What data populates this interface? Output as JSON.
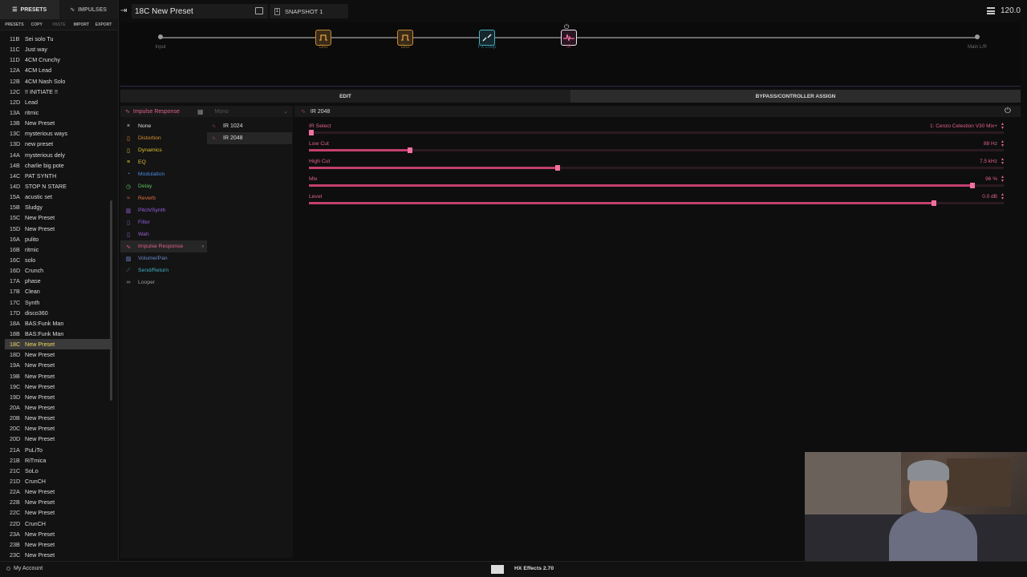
{
  "left_panel": {
    "tabs": [
      {
        "label": "PRESETS"
      },
      {
        "label": "IMPULSES"
      }
    ],
    "actions": [
      "PRESETS",
      "COPY",
      "PASTE",
      "IMPORT",
      "EXPORT"
    ],
    "presets": [
      {
        "id": "11B",
        "name": "Sei solo Tu"
      },
      {
        "id": "11C",
        "name": "Just way"
      },
      {
        "id": "11D",
        "name": "4CM Crunchy"
      },
      {
        "id": "12A",
        "name": "4CM Lead"
      },
      {
        "id": "12B",
        "name": "4CM Nash Solo"
      },
      {
        "id": "12C",
        "name": "!! INITIATE !!"
      },
      {
        "id": "12D",
        "name": "Lead"
      },
      {
        "id": "13A",
        "name": "ritmic"
      },
      {
        "id": "13B",
        "name": "New Preset"
      },
      {
        "id": "13C",
        "name": "mysterious ways"
      },
      {
        "id": "13D",
        "name": "new preset"
      },
      {
        "id": "14A",
        "name": "mysterious dely"
      },
      {
        "id": "14B",
        "name": "charlie big pote"
      },
      {
        "id": "14C",
        "name": "PAT SYNTH"
      },
      {
        "id": "14D",
        "name": "STOP N STARE"
      },
      {
        "id": "15A",
        "name": "acustic set"
      },
      {
        "id": "15B",
        "name": "Sludgy"
      },
      {
        "id": "15C",
        "name": "New Preset"
      },
      {
        "id": "15D",
        "name": "New Preset"
      },
      {
        "id": "16A",
        "name": "pulito"
      },
      {
        "id": "16B",
        "name": "ritmic"
      },
      {
        "id": "16C",
        "name": "solo"
      },
      {
        "id": "16D",
        "name": "Crunch"
      },
      {
        "id": "17A",
        "name": "phase"
      },
      {
        "id": "17B",
        "name": "Clean"
      },
      {
        "id": "17C",
        "name": "Synth"
      },
      {
        "id": "17D",
        "name": "disco360"
      },
      {
        "id": "18A",
        "name": "BAS:Funk Man"
      },
      {
        "id": "18B",
        "name": "BAS:Funk Man"
      },
      {
        "id": "18C",
        "name": "New Preset",
        "selected": true
      },
      {
        "id": "18D",
        "name": "New Preset"
      },
      {
        "id": "19A",
        "name": "New Preset"
      },
      {
        "id": "19B",
        "name": "New Preset"
      },
      {
        "id": "19C",
        "name": "New Preset"
      },
      {
        "id": "19D",
        "name": "New Preset"
      },
      {
        "id": "20A",
        "name": "New Preset"
      },
      {
        "id": "20B",
        "name": "New Preset"
      },
      {
        "id": "20C",
        "name": "New Preset"
      },
      {
        "id": "20D",
        "name": "New Preset"
      },
      {
        "id": "21A",
        "name": "PuLiTo"
      },
      {
        "id": "21B",
        "name": "RiTmica"
      },
      {
        "id": "21C",
        "name": "SoLo"
      },
      {
        "id": "21D",
        "name": "CrunCH"
      },
      {
        "id": "22A",
        "name": "New Preset"
      },
      {
        "id": "22B",
        "name": "New Preset"
      },
      {
        "id": "22C",
        "name": "New Preset"
      },
      {
        "id": "22D",
        "name": "CrunCH"
      },
      {
        "id": "23A",
        "name": "New Preset"
      },
      {
        "id": "23B",
        "name": "New Preset"
      },
      {
        "id": "23C",
        "name": "New Preset"
      }
    ]
  },
  "topbar": {
    "preset_name": "18C  New Preset",
    "snapshot_badge": "1",
    "snapshot_label": "SNAPSHOT 1",
    "tempo": "120.0"
  },
  "chain": {
    "input_label": "Input",
    "output_label": "Main L/R",
    "blocks": [
      {
        "label": "Dist",
        "kind": "dist"
      },
      {
        "label": "Dist",
        "kind": "dist"
      },
      {
        "label": "FX Loop",
        "kind": "fx"
      },
      {
        "label": "IR",
        "kind": "ir"
      }
    ]
  },
  "edit_tabs": {
    "edit": "EDIT",
    "bypass": "BYPASS/CONTROLLER ASSIGN"
  },
  "categories": {
    "header": "Impulse Response",
    "mono": "Mono",
    "items": [
      {
        "label": "None",
        "icon": "×",
        "color": "#dddddd"
      },
      {
        "label": "Distortion",
        "icon": "▯",
        "color": "#d9902f"
      },
      {
        "label": "Dynamics",
        "icon": "▯",
        "color": "#e0c030"
      },
      {
        "label": "EQ",
        "icon": "≡",
        "color": "#e0c030"
      },
      {
        "label": "Modulation",
        "icon": "◔",
        "color": "#4a8ae0"
      },
      {
        "label": "Delay",
        "icon": "◷",
        "color": "#5ac05a"
      },
      {
        "label": "Reverb",
        "icon": "≈",
        "color": "#e07040"
      },
      {
        "label": "Pitch/Synth",
        "icon": "▥",
        "color": "#9a60e0"
      },
      {
        "label": "Filter",
        "icon": "▯",
        "color": "#8a5ad0"
      },
      {
        "label": "Wah",
        "icon": "▯",
        "color": "#9a60d0"
      },
      {
        "label": "Impulse Response",
        "icon": "∿",
        "color": "#e06090",
        "active": true
      },
      {
        "label": "Volume/Pan",
        "icon": "▨",
        "color": "#6a8ad0"
      },
      {
        "label": "Send/Return",
        "icon": "⟋",
        "color": "#40b0c0"
      },
      {
        "label": "Looper",
        "icon": "∞",
        "color": "#9a9a9a"
      }
    ],
    "models": [
      {
        "label": "IR 1024"
      },
      {
        "label": "IR 2048",
        "active": true
      }
    ]
  },
  "params": {
    "header": "IR 2048",
    "items": [
      {
        "name": "IR Select",
        "value": "1: Cenzo Celestion V30 Mix+",
        "level": 0.0
      },
      {
        "name": "Low Cut",
        "value": "88 Hz",
        "level": 0.145
      },
      {
        "name": "High Cut",
        "value": "7.5 kHz",
        "level": 0.358
      },
      {
        "name": "Mix",
        "value": "96 %",
        "level": 0.955
      },
      {
        "name": "Level",
        "value": "0.0 dB",
        "level": 0.9
      }
    ]
  },
  "footer": {
    "account": "My Account",
    "version": "HX Effects 2.70"
  }
}
